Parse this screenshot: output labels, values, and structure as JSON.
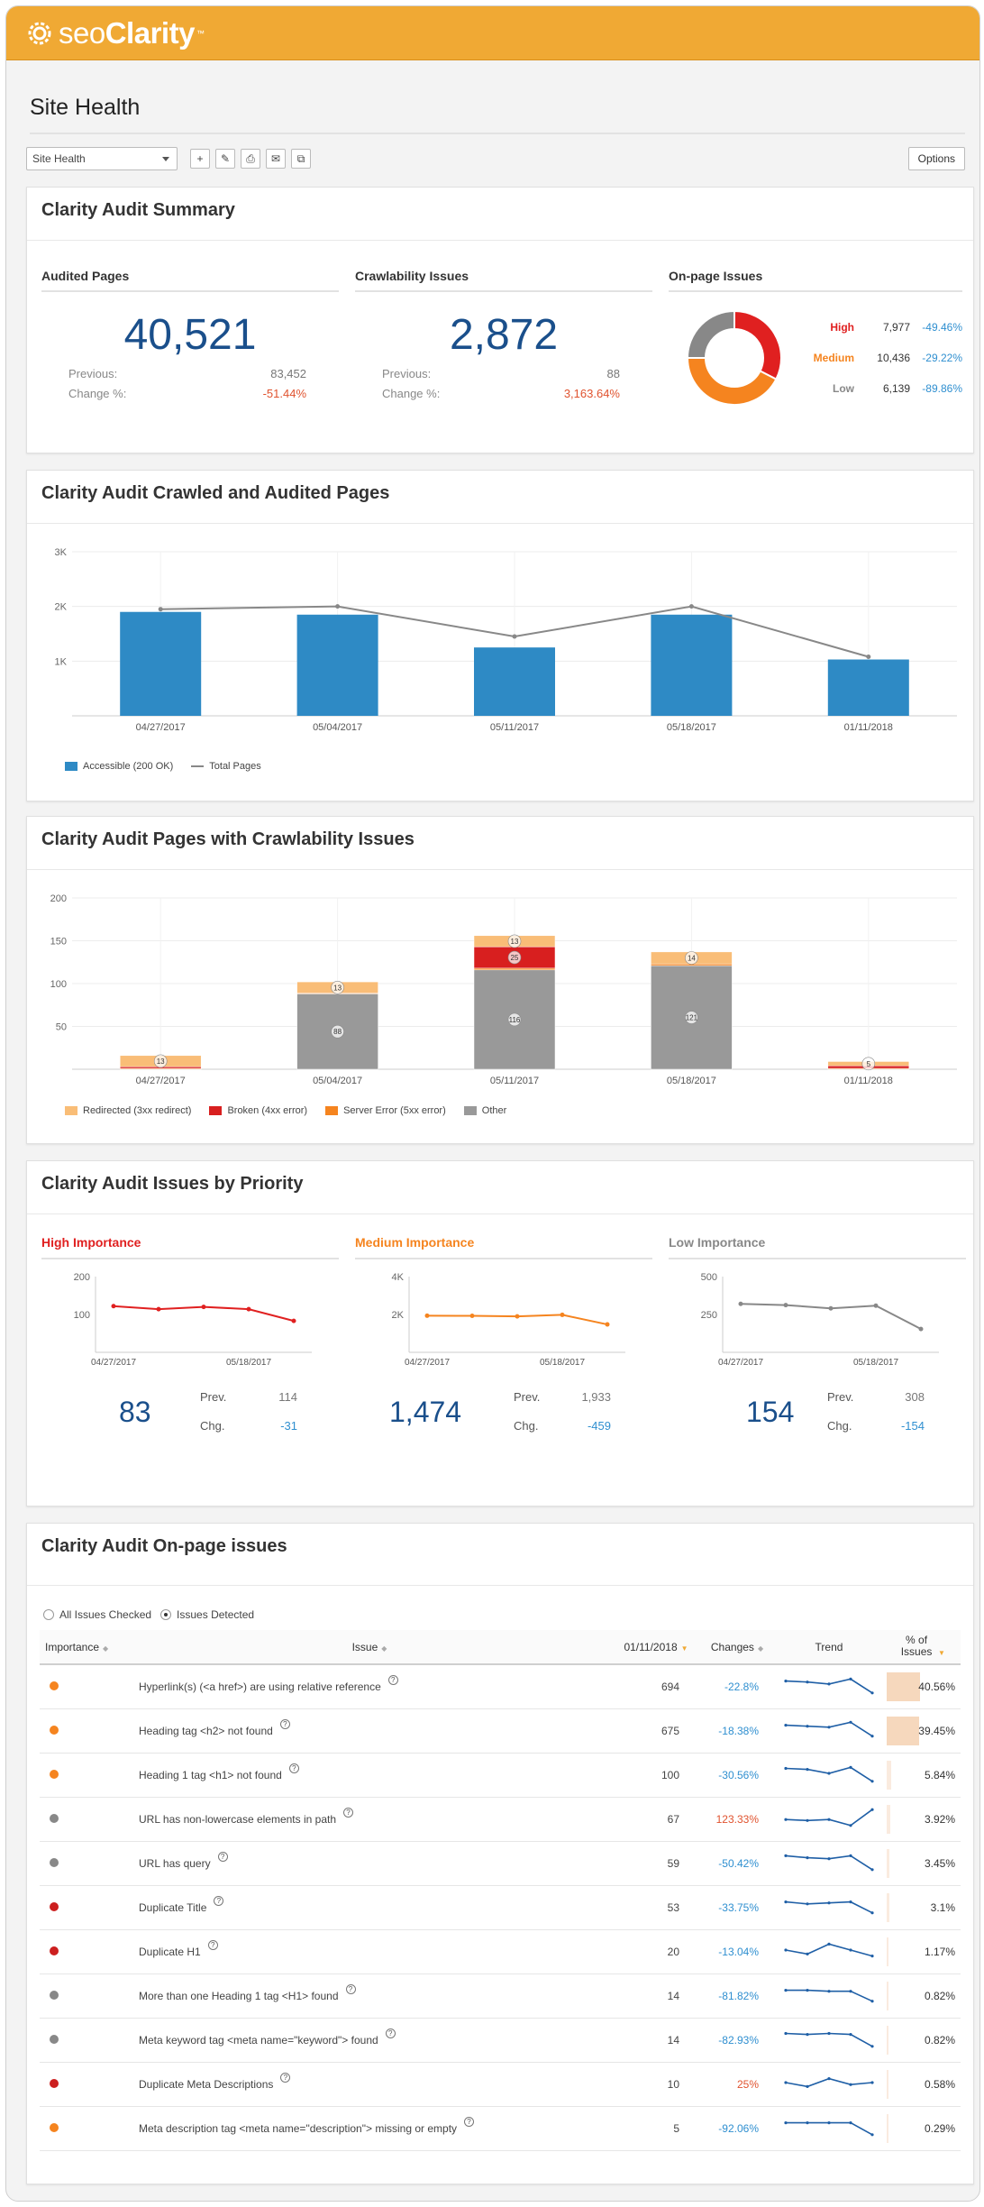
{
  "app": {
    "logo_seo": "seo",
    "logo_clarity": "Clarity",
    "logo_tm": "™",
    "page_title": "Site Health"
  },
  "toolbar": {
    "select_value": "Site Health",
    "options_label": "Options",
    "icons": [
      "plus-icon",
      "edit-icon",
      "print-icon",
      "email-icon",
      "copy-icon"
    ]
  },
  "summary": {
    "title": "Clarity Audit Summary",
    "audited": {
      "label": "Audited Pages",
      "value": "40,521",
      "prev_label": "Previous:",
      "prev": "83,452",
      "change_label": "Change %:",
      "change": "-51.44%"
    },
    "crawl": {
      "label": "Crawlability Issues",
      "value": "2,872",
      "prev_label": "Previous:",
      "prev": "88",
      "change_label": "Change %:",
      "change": "3,163.64%"
    },
    "onpage": {
      "label": "On-page Issues",
      "rows": [
        {
          "name": "High",
          "count": "7,977",
          "change": "-49.46%",
          "color": "#e02020"
        },
        {
          "name": "Medium",
          "count": "10,436",
          "change": "-29.22%",
          "color": "#f5841f"
        },
        {
          "name": "Low",
          "count": "6,139",
          "change": "-89.86%",
          "color": "#888888"
        }
      ],
      "donut_values": [
        7977,
        10436,
        6139
      ]
    }
  },
  "crawled": {
    "title": "Clarity Audit Crawled and Audited Pages",
    "legend_bar": "Accessible (200 OK)",
    "legend_line": "Total Pages"
  },
  "crawlability": {
    "title": "Clarity Audit Pages with Crawlability Issues",
    "legend": [
      "Redirected (3xx redirect)",
      "Broken (4xx error)",
      "Server Error (5xx error)",
      "Other"
    ]
  },
  "priority": {
    "title": "Clarity Audit Issues by Priority",
    "cols": [
      {
        "label": "High Importance",
        "value": "83",
        "prev_label": "Prev.",
        "prev": "114",
        "chg_label": "Chg.",
        "chg": "-31",
        "color": "#e02020",
        "y_ticks": [
          "200",
          "100"
        ],
        "x_ticks": [
          "04/27/2017",
          "05/18/2017"
        ]
      },
      {
        "label": "Medium Importance",
        "value": "1,474",
        "prev_label": "Prev.",
        "prev": "1,933",
        "chg_label": "Chg.",
        "chg": "-459",
        "color": "#f5841f",
        "y_ticks": [
          "4K",
          "2K"
        ],
        "x_ticks": [
          "04/27/2017",
          "05/18/2017"
        ]
      },
      {
        "label": "Low Importance",
        "value": "154",
        "prev_label": "Prev.",
        "prev": "308",
        "chg_label": "Chg.",
        "chg": "-154",
        "color": "#888888",
        "y_ticks": [
          "500",
          "250"
        ],
        "x_ticks": [
          "04/27/2017",
          "05/18/2017"
        ]
      }
    ]
  },
  "onpage_table": {
    "title": "Clarity Audit On-page issues",
    "radio_all": "All Issues Checked",
    "radio_detected": "Issues Detected",
    "headers": [
      "Importance",
      "Issue",
      "01/11/2018",
      "Changes",
      "Trend",
      "% of Issues"
    ],
    "help_glyph": "?",
    "rows": [
      {
        "color": "#f5841f",
        "issue": "Hyperlink(s) (<a href>) are using relative reference",
        "count": "694",
        "change": "-22.8%",
        "change_color": "#2f8fd0",
        "pct": "40.56%",
        "pct_value": 40.56,
        "trend": [
          0.3,
          0.35,
          0.45,
          0.2,
          0.9
        ]
      },
      {
        "color": "#f5841f",
        "issue": "Heading tag <h2> not found",
        "count": "675",
        "change": "-18.38%",
        "change_color": "#2f8fd0",
        "pct": "39.45%",
        "pct_value": 39.45,
        "trend": [
          0.3,
          0.35,
          0.4,
          0.15,
          0.85
        ]
      },
      {
        "color": "#f5841f",
        "issue": "Heading 1 tag <h1> not found",
        "count": "100",
        "change": "-30.56%",
        "change_color": "#2f8fd0",
        "pct": "5.84%",
        "pct_value": 5.84,
        "trend": [
          0.25,
          0.3,
          0.5,
          0.2,
          0.9
        ]
      },
      {
        "color": "#888888",
        "issue": "URL has non-lowercase elements in path",
        "count": "67",
        "change": "123.33%",
        "change_color": "#e0532f",
        "pct": "3.92%",
        "pct_value": 3.92,
        "trend": [
          0.6,
          0.65,
          0.6,
          0.9,
          0.1
        ]
      },
      {
        "color": "#888888",
        "issue": "URL has query",
        "count": "59",
        "change": "-50.42%",
        "change_color": "#2f8fd0",
        "pct": "3.45%",
        "pct_value": 3.45,
        "trend": [
          0.2,
          0.3,
          0.35,
          0.2,
          0.9
        ]
      },
      {
        "color": "#cc1f1f",
        "issue": "Duplicate Title",
        "count": "53",
        "change": "-33.75%",
        "change_color": "#2f8fd0",
        "pct": "3.1%",
        "pct_value": 3.1,
        "trend": [
          0.3,
          0.4,
          0.35,
          0.3,
          0.85
        ]
      },
      {
        "color": "#cc1f1f",
        "issue": "Duplicate H1",
        "count": "20",
        "change": "-13.04%",
        "change_color": "#2f8fd0",
        "pct": "1.17%",
        "pct_value": 1.17,
        "trend": [
          0.5,
          0.7,
          0.2,
          0.5,
          0.8
        ]
      },
      {
        "color": "#888888",
        "issue": "More than one Heading 1 tag <H1> found",
        "count": "14",
        "change": "-81.82%",
        "change_color": "#2f8fd0",
        "pct": "0.82%",
        "pct_value": 0.82,
        "trend": [
          0.3,
          0.3,
          0.35,
          0.35,
          0.85
        ]
      },
      {
        "color": "#888888",
        "issue": "Meta keyword tag <meta name=\"keyword\"> found",
        "count": "14",
        "change": "-82.93%",
        "change_color": "#2f8fd0",
        "pct": "0.82%",
        "pct_value": 0.82,
        "trend": [
          0.25,
          0.3,
          0.25,
          0.3,
          0.9
        ]
      },
      {
        "color": "#cc1f1f",
        "issue": "Duplicate Meta Descriptions",
        "count": "10",
        "change": "25%",
        "change_color": "#e0532f",
        "pct": "0.58%",
        "pct_value": 0.58,
        "trend": [
          0.5,
          0.7,
          0.3,
          0.6,
          0.5
        ]
      },
      {
        "color": "#f5841f",
        "issue": "Meta description tag <meta name=\"description\"> missing or empty",
        "count": "5",
        "change": "-92.06%",
        "change_color": "#2f8fd0",
        "pct": "0.29%",
        "pct_value": 0.29,
        "trend": [
          0.3,
          0.3,
          0.3,
          0.3,
          0.9
        ]
      }
    ]
  },
  "chart_data": [
    {
      "type": "bar",
      "title": "Clarity Audit Crawled and Audited Pages",
      "categories": [
        "04/27/2017",
        "05/04/2017",
        "05/11/2017",
        "05/18/2017",
        "01/11/2018"
      ],
      "series": [
        {
          "name": "Accessible (200 OK)",
          "type": "bar",
          "values": [
            1900,
            1850,
            1250,
            1850,
            1030
          ],
          "color": "#2e8ac5"
        },
        {
          "name": "Total Pages",
          "type": "line",
          "values": [
            1950,
            2000,
            1450,
            2000,
            1080
          ],
          "color": "#888888"
        }
      ],
      "y_ticks": [
        "3K",
        "2K",
        "1K"
      ],
      "ylim": [
        0,
        3000
      ],
      "legend_position": "bottom-left"
    },
    {
      "type": "bar",
      "title": "Clarity Audit Pages with Crawlability Issues",
      "stacked": true,
      "categories": [
        "04/27/2017",
        "05/04/2017",
        "05/11/2017",
        "05/18/2017",
        "01/11/2018"
      ],
      "series": [
        {
          "name": "Other",
          "values": [
            0,
            88,
            116,
            121,
            0
          ],
          "color": "#999999"
        },
        {
          "name": "Server Error (5xx error)",
          "values": [
            1,
            1,
            2,
            2,
            1
          ],
          "color": "#f5841f"
        },
        {
          "name": "Broken (4xx error)",
          "values": [
            2,
            0,
            25,
            0,
            3
          ],
          "color": "#d81f1f"
        },
        {
          "name": "Redirected (3xx redirect)",
          "values": [
            13,
            13,
            13,
            14,
            5
          ],
          "color": "#f9bd77"
        }
      ],
      "data_labels": [
        {
          "category": "04/27/2017",
          "series": "Redirected (3xx redirect)",
          "text": "13"
        },
        {
          "category": "05/04/2017",
          "series": "Redirected (3xx redirect)",
          "text": "13"
        },
        {
          "category": "05/04/2017",
          "series": "Other",
          "text": "88"
        },
        {
          "category": "05/11/2017",
          "series": "Redirected (3xx redirect)",
          "text": "13"
        },
        {
          "category": "05/11/2017",
          "series": "Broken (4xx error)",
          "text": "25"
        },
        {
          "category": "05/11/2017",
          "series": "Other",
          "text": "116"
        },
        {
          "category": "05/18/2017",
          "series": "Redirected (3xx redirect)",
          "text": "14"
        },
        {
          "category": "05/18/2017",
          "series": "Other",
          "text": "121"
        },
        {
          "category": "01/11/2018",
          "series": "Redirected (3xx redirect)",
          "text": "5"
        }
      ],
      "y_ticks": [
        "200",
        "150",
        "100",
        "50"
      ],
      "ylim": [
        0,
        200
      ],
      "legend_position": "bottom-left"
    },
    {
      "type": "line",
      "title": "High Importance",
      "x": [
        "04/27/2017",
        "05/04/2017",
        "05/11/2017",
        "05/18/2017",
        "01/11/2018"
      ],
      "values": [
        122,
        114,
        120,
        114,
        83
      ],
      "ylim": [
        0,
        200
      ],
      "color": "#e02020"
    },
    {
      "type": "line",
      "title": "Medium Importance",
      "x": [
        "04/27/2017",
        "05/04/2017",
        "05/11/2017",
        "05/18/2017",
        "01/11/2018"
      ],
      "values": [
        1933,
        1930,
        1900,
        1980,
        1474
      ],
      "ylim": [
        0,
        4000
      ],
      "color": "#f5841f"
    },
    {
      "type": "line",
      "title": "Low Importance",
      "x": [
        "04/27/2017",
        "05/04/2017",
        "05/11/2017",
        "05/18/2017",
        "01/11/2018"
      ],
      "values": [
        320,
        312,
        290,
        308,
        154
      ],
      "ylim": [
        0,
        500
      ],
      "color": "#888888"
    }
  ]
}
